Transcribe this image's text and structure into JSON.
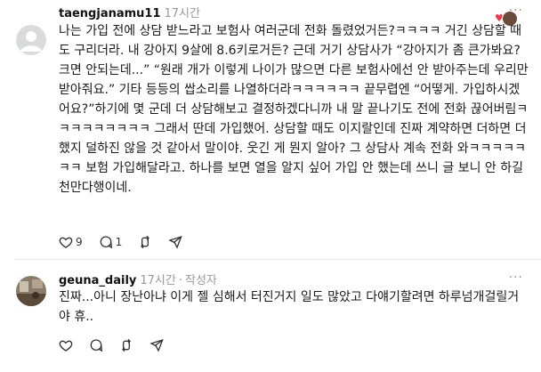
{
  "posts": [
    {
      "username": "taengjanamu11",
      "time": "17시간",
      "author_tag": "",
      "text": "나는 가입 전에 상담 받느라고 보험사 여러군데 전화 돌렸었거든?ㅋㅋㅋㅋ 거긴 상담할 때도 구리더라. 내 강아지 9살에 8.6키로거든? 근데 거기 상담사가 “강아지가 좀 큰가봐요? 크면 안되는데...” “원래 개가 이렇게 나이가 많으면 다른 보험사에선 안 받아주는데 우리만 받아줘요.” 기타 등등의 쌉소리를 나열하더라ㅋㅋㅋㅋㅋㅋ 끝무렵엔 “어떻게. 가입하시겠어요?”하기에 몇 군데 더 상담해보고 결정하겠다니까 내 말 끝나기도 전에 전화 끊어버림ㅋㅋㅋㅋㅋㅋㅋㅋㅋ 그래서 딴데 가입했어. 상담할 때도 이지랄인데 진짜 계약하면 더하면 더했지 덜하진 않을 것 같아서 말이야. 웃긴 게 뭔지 알아? 그 상담사 계속 전화 와ㅋㅋㅋㅋㅋㅋㅋ 보험 가입해달라고. 하나를 보면 열을 알지 싶어 가입 안 했는데 쓰니 글 보니 안 하길 천만다행이네.",
      "likes": "9",
      "replies": "1",
      "liked_by_icon": "heart-icon"
    },
    {
      "username": "geuna_daily",
      "time": "17시간",
      "author_tag": "작성자",
      "text": "진짜...아니 장난아냐 이게 젤 심해서 터진거지 일도 많았고 다얘기할려면 하루넘개걸릴거야 휴..",
      "likes": "",
      "replies": "",
      "liked_by_icon": ""
    }
  ],
  "more_label": "···",
  "colors": {
    "heart": "#ff3040",
    "meta": "#999999",
    "text": "#1a1a1a"
  }
}
